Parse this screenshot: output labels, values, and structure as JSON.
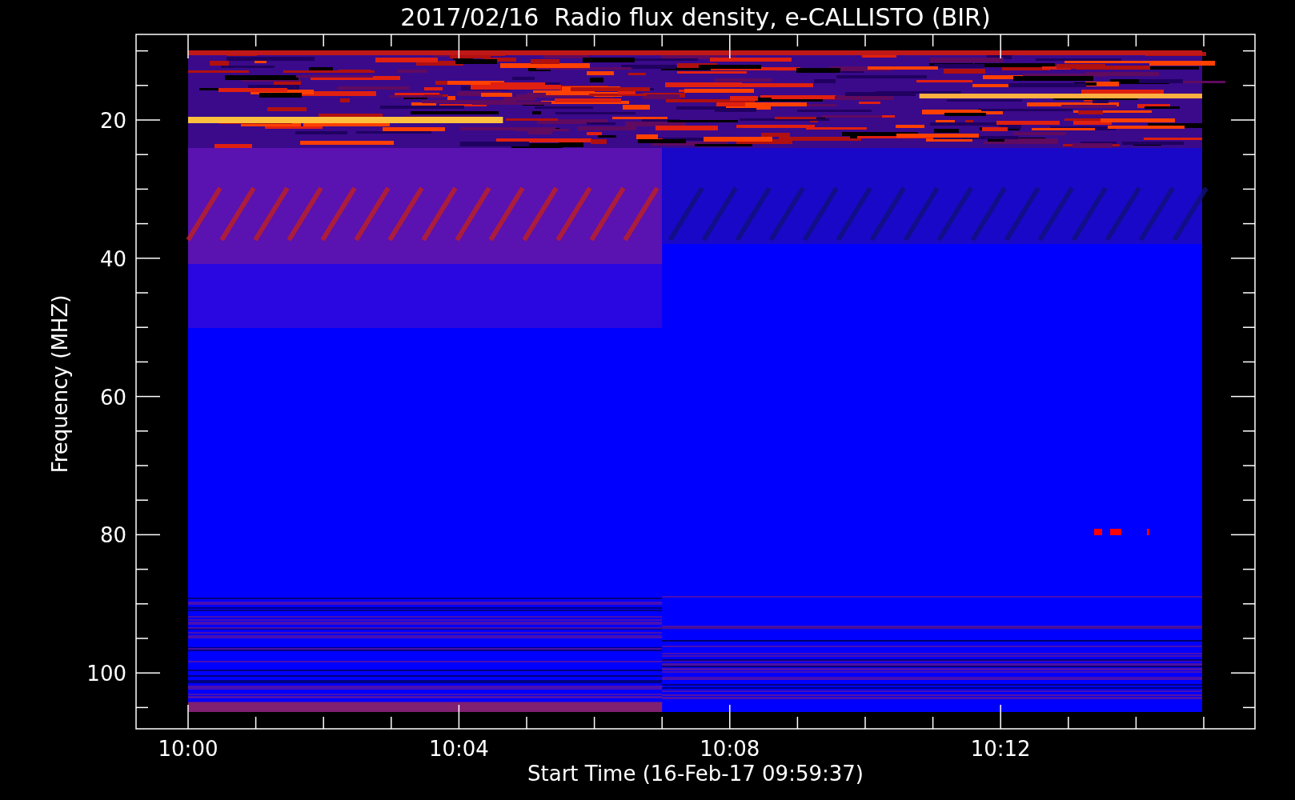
{
  "plot": {
    "title": "2017/02/16  Radio flux density, e-CALLISTO (BIR)",
    "xlabel": "Start Time (16-Feb-17 09:59:37)",
    "ylabel": "Frequency (MHZ)",
    "yticks": [
      "20",
      "40",
      "60",
      "80",
      "100"
    ],
    "xticks": [
      "10:00",
      "10:04",
      "10:08",
      "10:12"
    ]
  }
}
